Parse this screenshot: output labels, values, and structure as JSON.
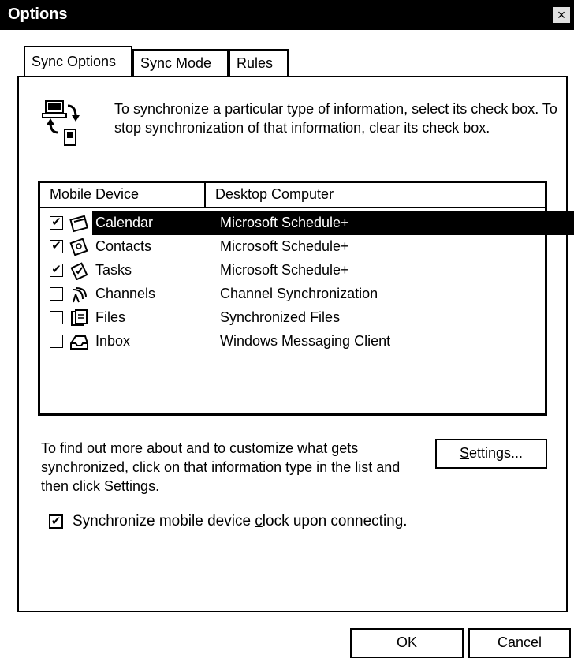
{
  "window": {
    "title": "Options",
    "close_glyph": "×"
  },
  "tabs": [
    {
      "label": "Sync Options",
      "active": true
    },
    {
      "label": "Sync Mode",
      "active": false
    },
    {
      "label": "Rules",
      "active": false
    }
  ],
  "intro_text": "To synchronize a particular type of information, select its check box. To stop synchronization of that information, clear its check box.",
  "sync_icon": "sync-computer-device-icon",
  "list": {
    "columns": [
      "Mobile Device",
      "Desktop Computer"
    ],
    "rows": [
      {
        "checked": true,
        "icon": "calendar-icon",
        "device": "Calendar",
        "desktop": "Microsoft Schedule+",
        "selected": true
      },
      {
        "checked": true,
        "icon": "contacts-icon",
        "device": "Contacts",
        "desktop": "Microsoft Schedule+",
        "selected": false
      },
      {
        "checked": true,
        "icon": "tasks-icon",
        "device": "Tasks",
        "desktop": "Microsoft Schedule+",
        "selected": false
      },
      {
        "checked": false,
        "icon": "channels-icon",
        "device": "Channels",
        "desktop": "Channel Synchronization",
        "selected": false
      },
      {
        "checked": false,
        "icon": "files-icon",
        "device": "Files",
        "desktop": "Synchronized Files",
        "selected": false
      },
      {
        "checked": false,
        "icon": "inbox-icon",
        "device": "Inbox",
        "desktop": "Windows Messaging Client",
        "selected": false
      }
    ]
  },
  "info_text": "To find out more about and to customize what gets synchronized, click on that information type in the list and then click Settings.",
  "settings_button": {
    "prefix": "",
    "accel": "S",
    "suffix": "ettings..."
  },
  "clock_option": {
    "checked": true,
    "prefix": "Synchronize mobile device ",
    "accel": "c",
    "suffix": "lock upon connecting."
  },
  "buttons": {
    "ok": "OK",
    "cancel": "Cancel"
  },
  "check_glyph": "✔"
}
